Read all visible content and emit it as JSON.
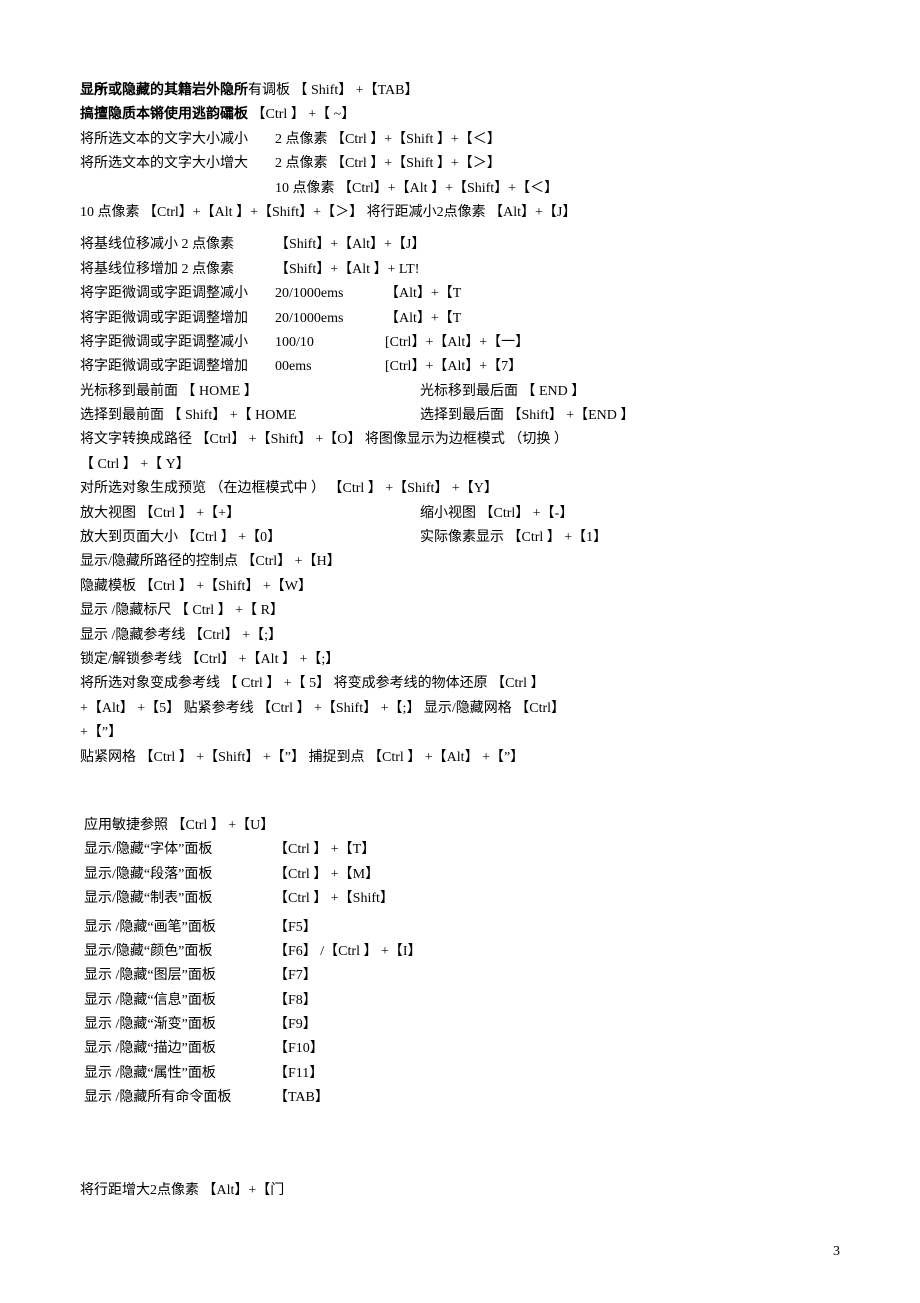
{
  "l1a": "显示或隐藏的其籍岩外隐所有调板 【 Shift】 +【TAB】",
  "l1b": "显所或隐藏的其籍岩外隐所",
  "l2a": "搞擅隐质本锵使用逃韵礵板 【Ctrl 】 +【 ~】",
  "l2b": "搞擅隐质本锵使用逃韵礵板",
  "l3_left": "将所选文本的文字大小减小",
  "l3_right": "2 点像素 【Ctrl 】+【Shift 】+【＜】",
  "l4_left": "将所选文本的文字大小增大",
  "l4_right": "2 点像素 【Ctrl 】+【Shift 】+【＞】",
  "l5_right": "10 点像素 【Ctrl】+【Alt 】+【Shift】+【＜】",
  "l6": " 10 点像素 【Ctrl】+【Alt 】+【Shift】+【＞】 将行距减小2点像素 【Alt】+【J】",
  "l7_left": "将基线位移减小 2 点像素",
  "l7_right": "【Shift】+【Alt】+【J】",
  "l8_left": "将基线位移增加 2 点像素",
  "l8_right": "【Shift】+【Alt 】+ LT!",
  "l9_c1": "将字距微调或字距调整减小",
  "l9_c2": "20/1000ems",
  "l9_c3": "【Alt】+【T",
  "l10_c1": "将字距微调或字距调整增加",
  "l10_c2": "20/1000ems",
  "l10_c3": "【Alt】+【T",
  "l11_c1": "将字距微调或字距调整减小",
  "l11_c2": "100/10",
  "l11_c3": "[Ctrl】+【Alt】+【一】",
  "l12_c1": "将字距微调或字距调整增加",
  "l12_c2": "00ems",
  "l12_c3": "[Ctrl】+【Alt】+【7】",
  "l13_l": "光标移到最前面   【 HOME 】",
  "l13_r": "光标移到最后面 【 END 】",
  "l14_l": "选择到最前面 【 Shift】 +【 HOME",
  "l14_r": "选择到最后面 【Shift】 +【END 】",
  "l15": "将文字转换成路径 【Ctrl】 +【Shift】 +【O】 将图像显示为边框模式     （切换 ）",
  "l16": "【 Ctrl 】 +【 Y】",
  "l17": "对所选对象生成预览    （在边框模式中 ） 【Ctrl 】 +【Shift】 +【Y】",
  "l18_l": "放大视图 【Ctrl 】 +【+】",
  "l18_r": "缩小视图 【Ctrl】 +【-】",
  "l19_l": "放大到页面大小 【Ctrl 】 +【0】",
  "l19_r": "实际像素显示 【Ctrl 】 +【1】",
  "l20": "显示/隐藏所路径的控制点     【Ctrl】 +【H】",
  "l21": "隐藏模板 【Ctrl 】 +【Shift】 +【W】",
  "l22": "显示 /隐藏标尺   【 Ctrl 】 +【 R】",
  "l23": "显示 /隐藏参考线    【Ctrl】 +【;】",
  "l24": "锁定/解锁参考线    【Ctrl】 +【Alt 】 +【;】",
  "l25": "将所选对象变成参考线 【 Ctrl 】 +【 5】 将变成参考线的物体还原 【Ctrl 】",
  "l26": "+【Alt】 +【5】 贴紧参考线 【Ctrl 】 +【Shift】 +【;】 显示/隐藏网格    【Ctrl】",
  "l27": "+【”】",
  "l28": "贴紧网格 【Ctrl 】 +【Shift】 +【”】 捕捉到点 【Ctrl 】 +【Alt】 +【”】",
  "p1": "应用敏捷参照 【Ctrl 】 +【U】",
  "p2_l": "显示/隐藏“字体”面板",
  "p2_r": "【Ctrl 】 +【T】",
  "p3_l": "显示/隐藏“段落”面板",
  "p3_r": "【Ctrl 】 +【M】",
  "p3b_l": "显示/隐藏“制表”面板",
  "p3b_r": "【Ctrl 】 +【Shift】",
  "p4_l": "显示 /隐藏“画笔”面板",
  "p4_r": "【F5】",
  "p5_l": "显示/隐藏“颜色”面板",
  "p5_r": "【F6】 /【Ctrl 】 +【I】",
  "p6_l": "显示 /隐藏“图层”面板",
  "p6_r": "【F7】",
  "p7_l": "显示 /隐藏“信息”面板",
  "p7_r": "【F8】",
  "p8_l": "显示 /隐藏“渐变”面板",
  "p8_r": "【F9】",
  "p9_l": "显示 /隐藏“描边”面板",
  "p9_r": "【F10】",
  "p10_l": "显示 /隐藏“属性”面板",
  "p10_r": "【F11】",
  "p11_l": "显示 /隐藏所有命令面板",
  "p11_r": "【TAB】",
  "footer": "将行距增大2点像素 【Alt】+【门",
  "pagenum": "3"
}
